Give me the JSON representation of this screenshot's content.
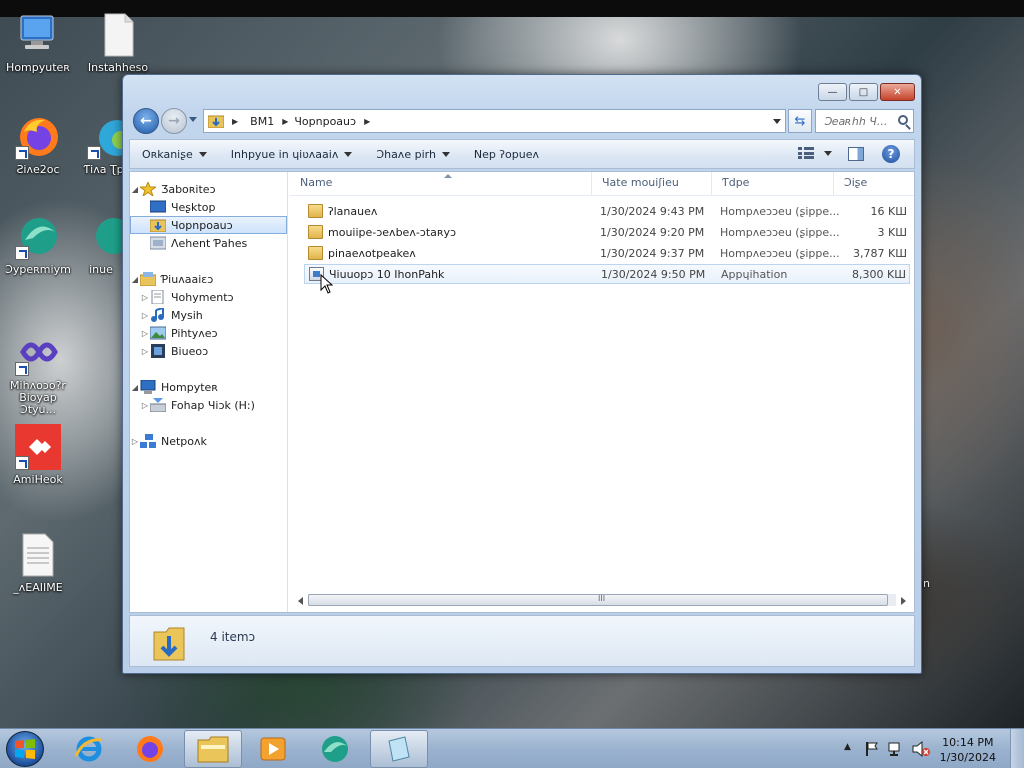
{
  "desktop": {
    "icons": [
      {
        "label": "Hompyuteʀ"
      },
      {
        "label": "Instahheso"
      },
      {
        "label": "Ƨiʌe2oc"
      },
      {
        "label": "Ƭiʌa Ʈpeli"
      },
      {
        "label": "Ɔypeʀmiym"
      },
      {
        "label": "inue"
      },
      {
        "label": "Mihʌoɔo?r Bioyap Ɔtyu..."
      },
      {
        "label": "AmiHeok"
      },
      {
        "label": "_ʌEAIIME"
      }
    ],
    "cropped_text": "in"
  },
  "window": {
    "controls": {
      "minimize": "—",
      "maximize": "□",
      "close": "✕"
    },
    "address": {
      "crumbs": [
        "BM1",
        "Ɥopnpoauɔ"
      ],
      "search_placeholder": "Ɔeaʀhh Ɥ..."
    },
    "toolbar": {
      "organize": "Oʀkaniʂe",
      "include": "Inhpyue in ɥiʋʌaaiʌ",
      "share": "Ɔhaʌe pirh",
      "new_folder": "Nep ʔopueʌ"
    },
    "nav": {
      "favorites": "Ʒaboʀiteɔ",
      "desktop": "Ɥeʂktop",
      "downloads": "Ɥopnpoauɔ",
      "recent": "Ʌehent Ƥahes",
      "libraries": "Ƥiuʌaaiɛɔ",
      "documents": "Ɥohymentɔ",
      "music": "Mysih",
      "pictures": "Pihtyʌeɔ",
      "videos": "Biueoɔ",
      "computer": "Hompyteʀ",
      "local_disk": "Fohap Ɥiɔk (H:)",
      "network": "Netpoʌk"
    },
    "columns": {
      "name": "Name",
      "date": "Ɥate mouiʃieu",
      "type": "Ƭdpe",
      "size": "Ɔiʂe"
    },
    "files": [
      {
        "name": "ʔlanaueʌ",
        "date": "1/30/2024 9:43 PM",
        "type": "Hompʌeɔɔeu (ʂippe...",
        "size": "16 KШ"
      },
      {
        "name": "mouiipe-ɔeʌbeʌ-ɔtaʀyɔ",
        "date": "1/30/2024 9:20 PM",
        "type": "Hompʌeɔɔeu (ʂippe...",
        "size": "3 KШ"
      },
      {
        "name": "pinaeʌotpeakeʌ",
        "date": "1/30/2024 9:37 PM",
        "type": "Hompʌeɔɔeu (ʂippe...",
        "size": "3,787 KШ"
      },
      {
        "name": "Ɥiuuopɔ 10 IhonPahk",
        "date": "1/30/2024 9:50 PM",
        "type": "Appɥihation",
        "size": "8,300 KШ"
      }
    ],
    "details": {
      "count_text": "4 itemɔ"
    }
  },
  "taskbar": {
    "apps": [
      "ie-icon",
      "firefox-icon",
      "explorer-icon",
      "media-player-icon",
      "messenger-icon",
      "notepad-icon"
    ],
    "clock": {
      "time": "10:14 PM",
      "date": "1/30/2024"
    }
  }
}
